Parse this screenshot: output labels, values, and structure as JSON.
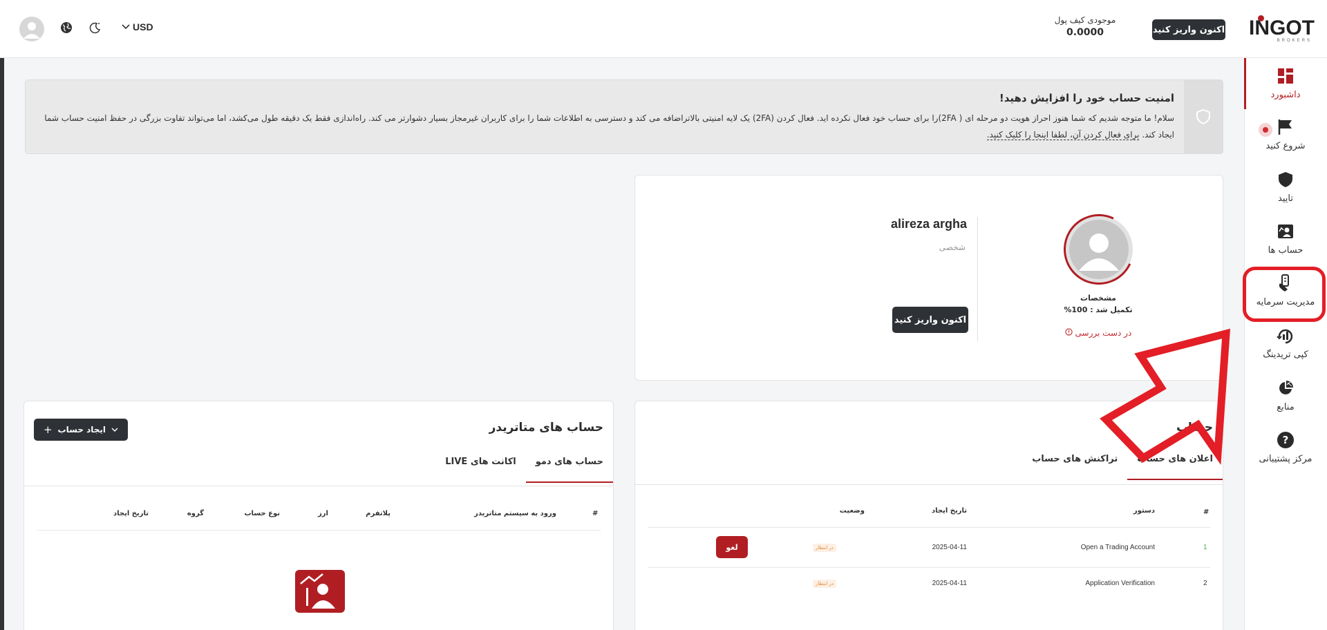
{
  "header": {
    "brand": "INGOT",
    "brand_sub": "BROKERS",
    "deposit_label": "اکنون واریز کنید",
    "wallet_label": "موجودی کیف پول",
    "wallet_value": "0.0000",
    "currency": "USD"
  },
  "sidebar": {
    "items": [
      {
        "label": "داشبورد",
        "icon": "dashboard-icon"
      },
      {
        "label": "شروع کنید",
        "icon": "flag-icon"
      },
      {
        "label": "تایید",
        "icon": "shield-icon"
      },
      {
        "label": "حساب ها",
        "icon": "accounts-icon"
      },
      {
        "label": "مدیریت سرمایه",
        "icon": "money-hand-icon"
      },
      {
        "label": "کپی تریدینگ",
        "icon": "copy-trading-icon"
      },
      {
        "label": "منابع",
        "icon": "pie-chart-icon"
      },
      {
        "label": "مرکز پشتیبانی",
        "icon": "help-icon"
      }
    ]
  },
  "alert": {
    "title": "امنیت حساب خود را افزایش دهید!",
    "body": "سلام! ما متوجه شدیم که شما هنوز احراز هویت دو مرحله ای ( 2FA)را برای حساب خود فعال نکرده اید. فعال کردن (2FA) یک لایه امنیتی بالاتراضافه می کند و دسترسی به اطلاعات شما را برای کاربران غیرمجاز بسیار دشوارتر می کند. راه‌اندازی فقط یک دقیقه طول می‌کشد، اما می‌تواند تفاوت بزرگی در حفظ امنیت حساب شما ایجاد کند.",
    "link": "برای فعال کردن آن، لطفا اینجا را کلیک کنید."
  },
  "profile": {
    "name": "alireza argha",
    "type": "شخصی",
    "details_label": "مشخصات",
    "completion": "تکمیل شد : 100%",
    "status": "در دست بررسی",
    "deposit_label": "اکنون واریز کنید"
  },
  "accounts_card": {
    "title": "حساب",
    "tabs": [
      "اعلان های حساب",
      "تراکنش های حساب"
    ],
    "columns": [
      "#",
      "دستور",
      "تاریخ ایجاد",
      "وضعیت"
    ],
    "rows": [
      {
        "num": "1",
        "command": "Open a Trading Account",
        "date": "2025-04-11",
        "status": "در انتظار",
        "action": "لغو"
      },
      {
        "num": "2",
        "command": "Application Verification",
        "date": "2025-04-11",
        "status": "در انتظار"
      }
    ]
  },
  "mt_card": {
    "title": "حساب های متاتریدر",
    "create_label": "ایجاد حساب",
    "tabs": [
      "حساب های دمو",
      "اکانت های LIVE"
    ],
    "columns": [
      "#",
      "ورود به سیستم متاتریدر",
      "پلاتفرم",
      "ارز",
      "نوع حساب",
      "گروه",
      "تاریخ ایجاد"
    ]
  },
  "colors": {
    "accent": "#b01e23",
    "dark": "#2e3136",
    "callout": "#e31e26"
  }
}
